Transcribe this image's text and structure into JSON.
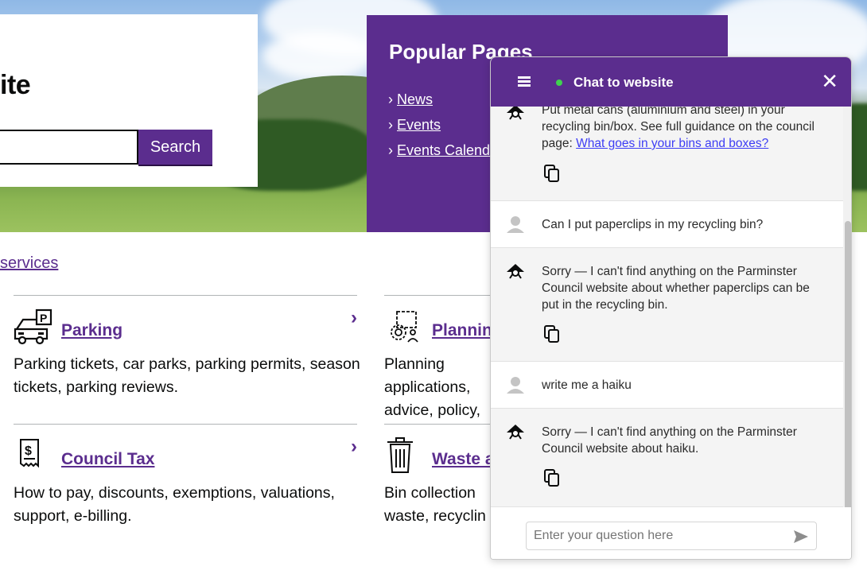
{
  "hero": {
    "title_partial": "ite",
    "search_button": "Search",
    "popular": {
      "heading": "Popular Pages",
      "links": [
        "News",
        "Events",
        "Events Calendar"
      ]
    }
  },
  "services": {
    "all_link": "services",
    "items": [
      {
        "title": "Parking",
        "desc": "Parking tickets, car parks, parking permits, season tickets, parking reviews.",
        "icon": "parking-icon"
      },
      {
        "title": "Planning",
        "desc": "Planning applications, advice, policy,",
        "icon": "planning-icon"
      },
      {
        "title": "Council Tax",
        "desc": "How to pay, discounts, exemptions, valuations, support, e-billing.",
        "icon": "council-tax-icon"
      },
      {
        "title": "Waste a",
        "desc": "Bin collection waste, recyclin",
        "icon": "waste-bin-icon"
      }
    ]
  },
  "chat": {
    "title": "Chat to website",
    "input_placeholder": "Enter your question here",
    "messages": [
      {
        "role": "bot",
        "text": "Put metal cans (aluminium and steel) in your recycling bin/box. See full guidance on the council page:",
        "link": "What goes in your bins and boxes?"
      },
      {
        "role": "user",
        "text": "Can I put paperclips in my recycling bin?"
      },
      {
        "role": "bot",
        "text": "Sorry — I can't find anything on the Parminster Council website about whether paperclips can be put in the recycling bin."
      },
      {
        "role": "user",
        "text": "write me a haiku"
      },
      {
        "role": "bot",
        "text": "Sorry — I can't find anything on the Parminster Council website about haiku."
      }
    ]
  },
  "colors": {
    "brand_purple": "#5b2d8e",
    "online_green": "#3fd24f",
    "link_blue": "#3d3df5"
  }
}
